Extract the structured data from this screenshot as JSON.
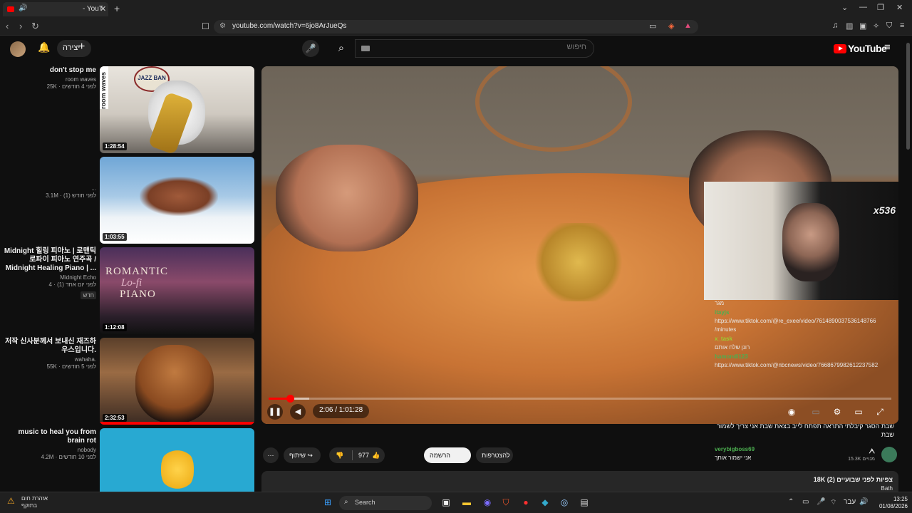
{
  "browser": {
    "tab_title": "- YouT",
    "url": "youtube.com/watch?v=6jo8ArJueQs"
  },
  "header": {
    "create_label": "יצירה",
    "search_placeholder": "חיפוש",
    "logo_text": "YouTube"
  },
  "recommendations": [
    {
      "title": "don't stop me",
      "channel": "room waves",
      "stats": "25K · לפני 4 חודשים",
      "duration": "1:28:54"
    },
    {
      "title": "",
      "channel": "...",
      "stats": "3.1M · לפני חודש (1)",
      "duration": "1:03:55"
    },
    {
      "title": "Midnight 힐링 피아노 | 로맨틱 로파이 피아노 연주곡 / Midnight Healing Piano | ...",
      "channel": "Midnight Echo",
      "stats": "4 · לפני יום אחד (1)",
      "badge": "חדש",
      "duration": "1:12:08"
    },
    {
      "title": "저작 신사분께서 보내신 재즈하우스입니다.",
      "channel": "wahaha.",
      "stats": "55K · לפני 5 חודשים",
      "duration": "2:32:53"
    },
    {
      "title": "music to heal you from brain rot",
      "channel": "nobody",
      "stats": "4.2M · לפני 10 חודשים",
      "duration": ""
    }
  ],
  "thumb_texts": {
    "romantic": "ROMANTIC",
    "lofi": "Lo-fi",
    "piano": "PIANO",
    "jazz": "JAZZ BAN",
    "room_waves": "room waves"
  },
  "player": {
    "time": "2:06 / 1:01:28",
    "progress_fraction": 0.034,
    "buffer_fraction": 0.065,
    "facecam_label": "x536"
  },
  "overlay_chat": [
    {
      "name": "",
      "msg": "מגר"
    },
    {
      "name": "itayjs",
      "msg": "https://www.tiktok.com/@re_exee/video/7614890037536148766 /minutes"
    },
    {
      "name": "x_task",
      "msg": "רונן שלח אותם"
    },
    {
      "name": "hamondi123",
      "msg": "https://www.tiktok.com/@nbcnews/video/7668679982612237582"
    }
  ],
  "below_chat": [
    {
      "name": "verybigboss69",
      "msg": "אני ישמור אותך"
    }
  ],
  "video_title_overlay": "שבת הסגר קיבלתי התראה תפתח לייב בצאת שבת אני צריך לשמור שבת",
  "actions": {
    "subscribe": "להצטרפות",
    "join": "הרשמה למינוי",
    "likes": "977",
    "share": "שיתוף"
  },
  "channel": {
    "name": "ᗅ",
    "subs": "15.3K מנויים"
  },
  "description": {
    "stats": "18K צפיות  לפני שבועיים (2)",
    "line2": "Bath"
  },
  "taskbar": {
    "warning_line1": "אזהרת חום",
    "warning_line2": "בתוקף",
    "search": "Search",
    "lang": "עבר",
    "time": "13:25",
    "date": "01/08/2026"
  }
}
